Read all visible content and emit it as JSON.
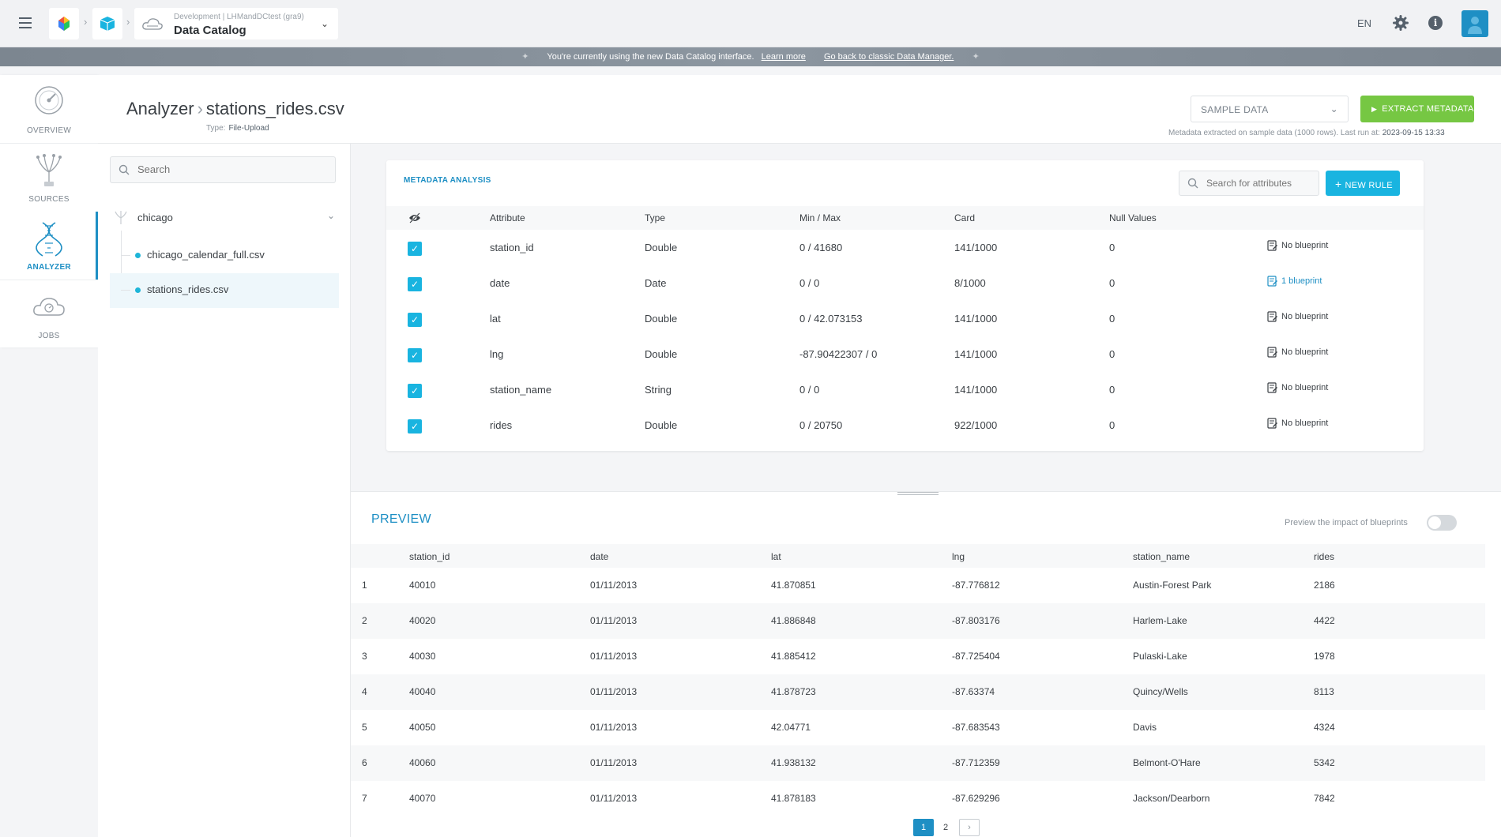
{
  "header": {
    "project_sub": "Development | LHMandDCtest (gra9)",
    "project_title": "Data Catalog",
    "lang": "EN"
  },
  "banner": {
    "message": "You're currently using the new Data Catalog interface.",
    "learn_more": "Learn more",
    "classic_link": "Go back to classic Data Manager."
  },
  "nav": {
    "items": [
      {
        "label": "OVERVIEW"
      },
      {
        "label": "SOURCES"
      },
      {
        "label": "ANALYZER"
      },
      {
        "label": "JOBS"
      }
    ]
  },
  "page": {
    "section": "Analyzer",
    "file": "stations_rides.csv",
    "type_label": "Type:",
    "type_value": "File-Upload",
    "sample_select": "SAMPLE DATA",
    "extract_button": "EXTRACT METADATA",
    "meta_note": "Metadata extracted on sample data (1000 rows).  Last run at:",
    "last_run": "2023-09-15 13:33"
  },
  "tree": {
    "search_placeholder": "Search",
    "root": "chicago",
    "leaves": [
      {
        "name": "chicago_calendar_full.csv"
      },
      {
        "name": "stations_rides.csv"
      }
    ]
  },
  "metadata": {
    "heading": "METADATA ANALYSIS",
    "search_placeholder": "Search for attributes",
    "new_rule": "NEW RULE",
    "columns": [
      "Attribute",
      "Type",
      "Min / Max",
      "Card",
      "Null Values"
    ],
    "rows": [
      {
        "attribute": "station_id",
        "type": "Double",
        "minmax": "0 / 41680",
        "card": "141/1000",
        "nulls": "0",
        "blueprint": "No blueprint"
      },
      {
        "attribute": "date",
        "type": "Date",
        "minmax": "0 / 0",
        "card": "8/1000",
        "nulls": "0",
        "blueprint": "1 blueprint"
      },
      {
        "attribute": "lat",
        "type": "Double",
        "minmax": "0 / 42.073153",
        "card": "141/1000",
        "nulls": "0",
        "blueprint": "No blueprint"
      },
      {
        "attribute": "lng",
        "type": "Double",
        "minmax": "-87.90422307 / 0",
        "card": "141/1000",
        "nulls": "0",
        "blueprint": "No blueprint"
      },
      {
        "attribute": "station_name",
        "type": "String",
        "minmax": "0 / 0",
        "card": "141/1000",
        "nulls": "0",
        "blueprint": "No blueprint"
      },
      {
        "attribute": "rides",
        "type": "Double",
        "minmax": "0 / 20750",
        "card": "922/1000",
        "nulls": "0",
        "blueprint": "No blueprint"
      }
    ]
  },
  "preview": {
    "title": "PREVIEW",
    "impact_label": "Preview the impact of blueprints",
    "columns": [
      "station_id",
      "date",
      "lat",
      "lng",
      "station_name",
      "rides"
    ],
    "rows": [
      [
        "1",
        "40010",
        "01/11/2013",
        "41.870851",
        "-87.776812",
        "Austin-Forest Park",
        "2186"
      ],
      [
        "2",
        "40020",
        "01/11/2013",
        "41.886848",
        "-87.803176",
        "Harlem-Lake",
        "4422"
      ],
      [
        "3",
        "40030",
        "01/11/2013",
        "41.885412",
        "-87.725404",
        "Pulaski-Lake",
        "1978"
      ],
      [
        "4",
        "40040",
        "01/11/2013",
        "41.878723",
        "-87.63374",
        "Quincy/Wells",
        "8113"
      ],
      [
        "5",
        "40050",
        "01/11/2013",
        "42.04771",
        "-87.683543",
        "Davis",
        "4324"
      ],
      [
        "6",
        "40060",
        "01/11/2013",
        "41.938132",
        "-87.712359",
        "Belmont-O'Hare",
        "5342"
      ],
      [
        "7",
        "40070",
        "01/11/2013",
        "41.878183",
        "-87.629296",
        "Jackson/Dearborn",
        "7842"
      ]
    ],
    "pages": [
      "1",
      "2"
    ],
    "next": "›"
  }
}
